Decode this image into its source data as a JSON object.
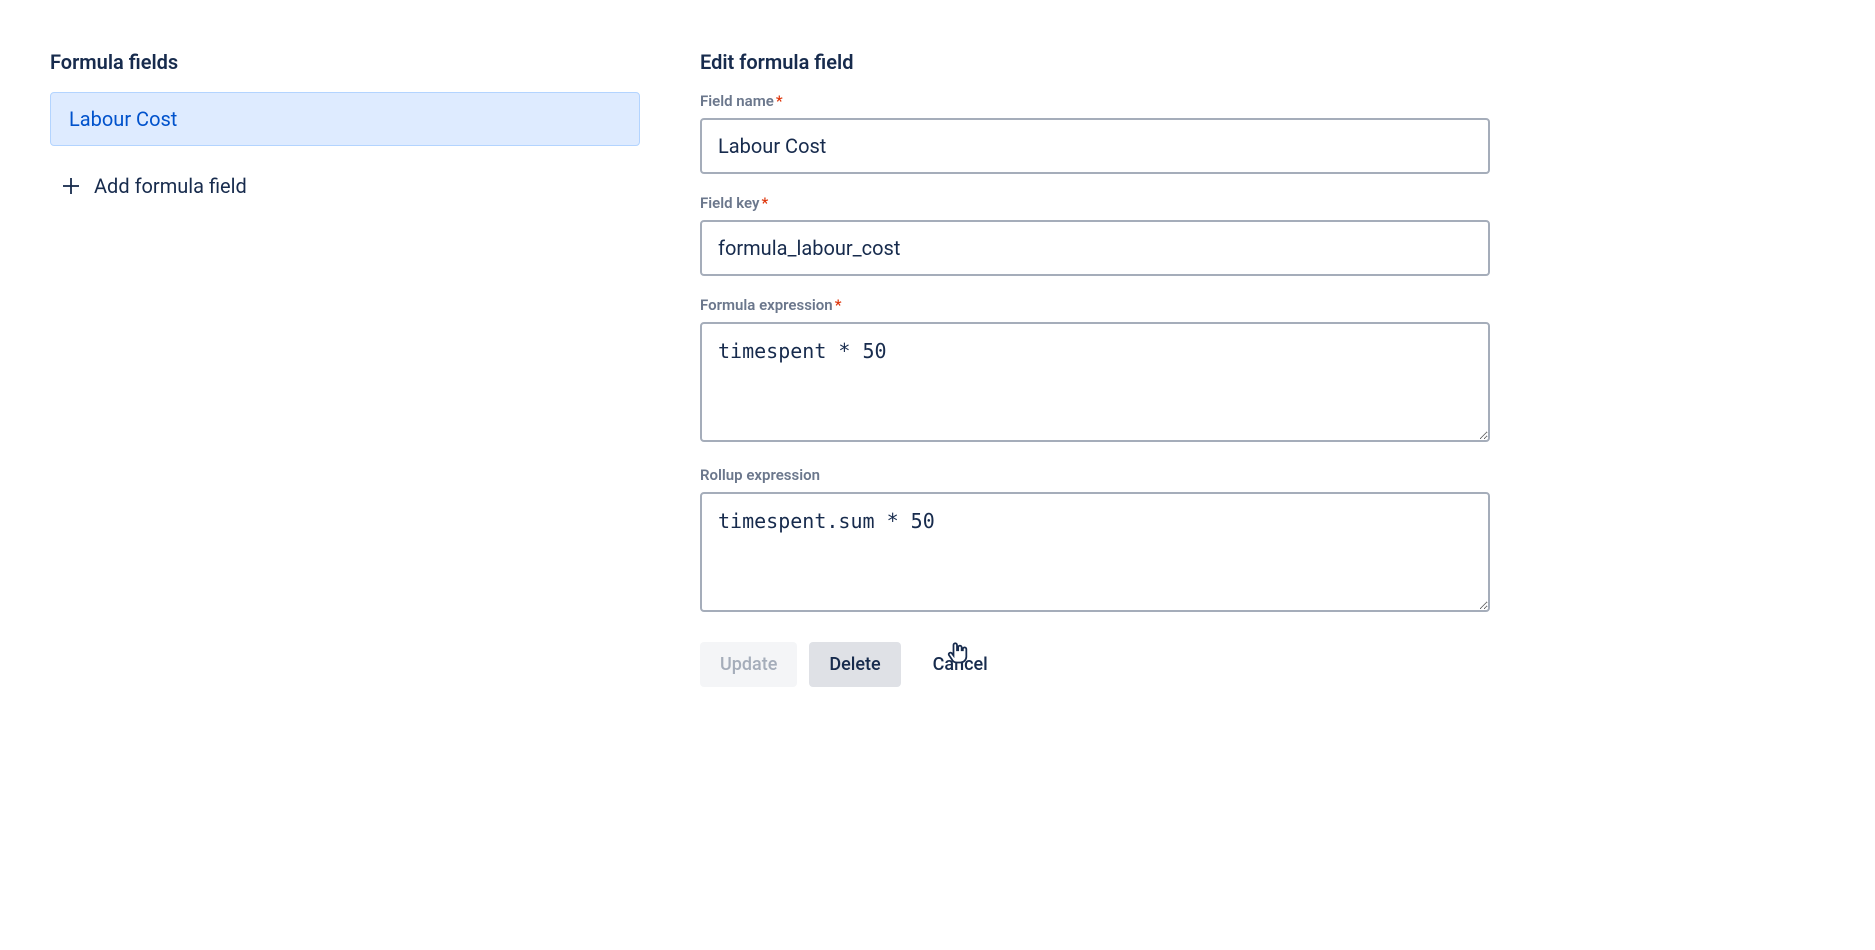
{
  "sidebar": {
    "title": "Formula fields",
    "items": [
      {
        "label": "Labour Cost"
      }
    ],
    "add_label": "Add formula field"
  },
  "main": {
    "title": "Edit formula field",
    "fields": {
      "field_name": {
        "label": "Field name",
        "required": true,
        "value": "Labour Cost"
      },
      "field_key": {
        "label": "Field key",
        "required": true,
        "value": "formula_labour_cost"
      },
      "formula_expression": {
        "label": "Formula expression",
        "required": true,
        "value": "timespent * 50"
      },
      "rollup_expression": {
        "label": "Rollup expression",
        "required": false,
        "value": "timespent.sum * 50"
      }
    },
    "buttons": {
      "update": "Update",
      "delete": "Delete",
      "cancel": "Cancel"
    }
  }
}
